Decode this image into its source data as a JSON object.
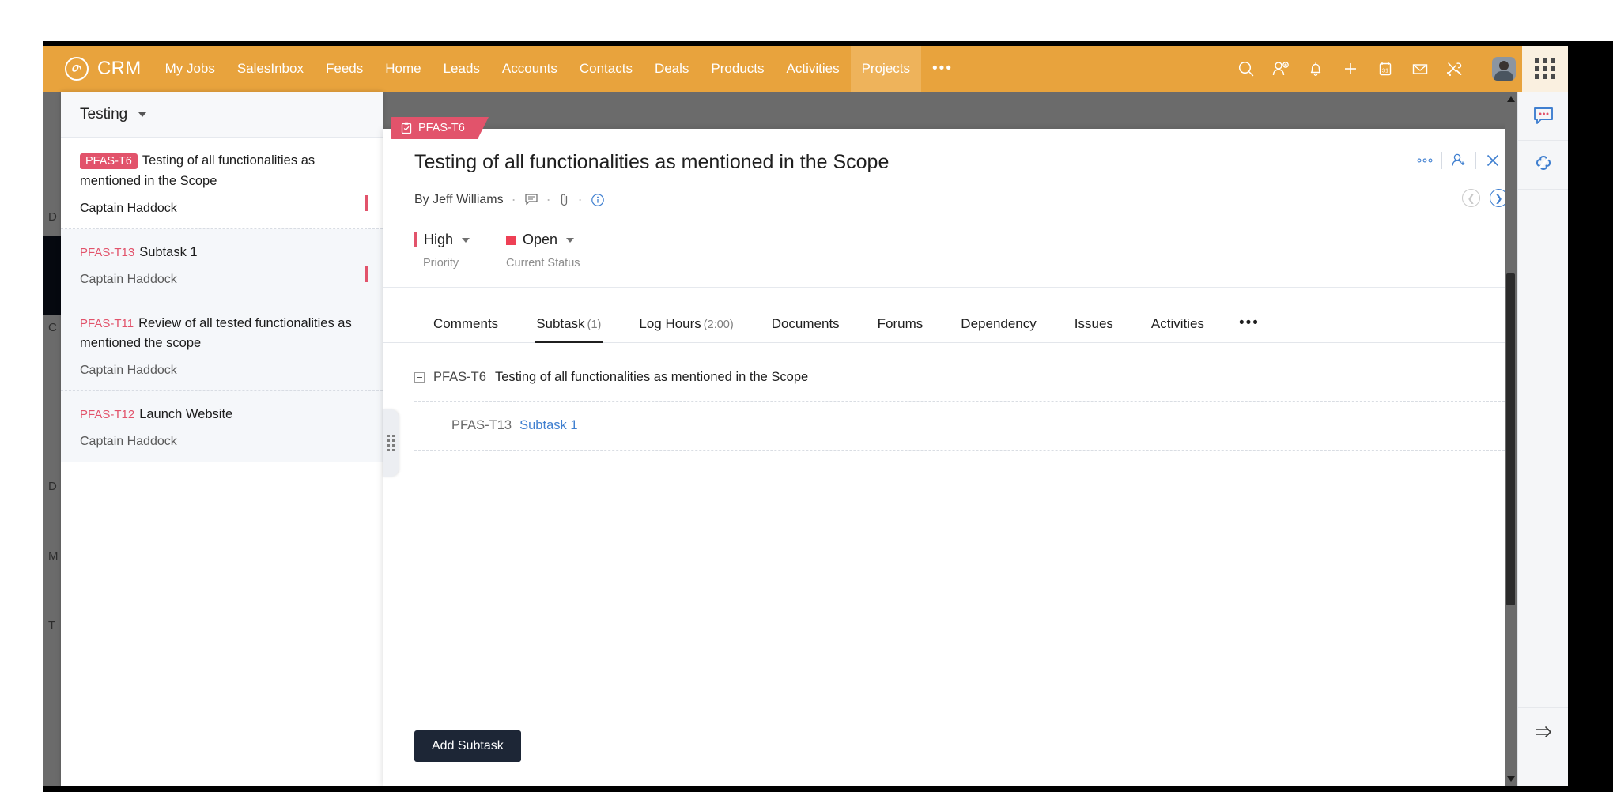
{
  "topnav": {
    "brand": "CRM",
    "brand_icon": "crm-logo-icon",
    "items": [
      {
        "label": "My Jobs",
        "active": false
      },
      {
        "label": "SalesInbox",
        "active": false
      },
      {
        "label": "Feeds",
        "active": false
      },
      {
        "label": "Home",
        "active": false
      },
      {
        "label": "Leads",
        "active": false
      },
      {
        "label": "Accounts",
        "active": false
      },
      {
        "label": "Contacts",
        "active": false
      },
      {
        "label": "Deals",
        "active": false
      },
      {
        "label": "Products",
        "active": false
      },
      {
        "label": "Activities",
        "active": false
      },
      {
        "label": "Projects",
        "active": true
      }
    ],
    "overflow_label": "•••",
    "icons": [
      "search-icon",
      "add-user-icon",
      "bell-icon",
      "plus-icon",
      "calendar-icon",
      "envelope-icon",
      "tools-icon"
    ],
    "calendar_day": "31",
    "accent_color": "#e8a33d",
    "active_tab_color": "#eeb35b"
  },
  "background_nav": {
    "labels": [
      "D",
      "C",
      "D",
      "M",
      "T"
    ]
  },
  "tasklist": {
    "title": "Testing",
    "dropdown_icon": "chevron-down-icon",
    "items": [
      {
        "key": "PFAS-T6",
        "name": "Testing of all functionalities as mentioned in the Scope",
        "owner": "Captain Haddock",
        "selected": true,
        "has_bar": true
      },
      {
        "key": "PFAS-T13",
        "name": "Subtask 1",
        "owner": "Captain Haddock",
        "selected": false,
        "has_bar": true
      },
      {
        "key": "PFAS-T11",
        "name": "Review of all tested functionalities as mentioned the scope",
        "owner": "Captain Haddock",
        "selected": false,
        "has_bar": false
      },
      {
        "key": "PFAS-T12",
        "name": "Launch Website",
        "owner": "Captain Haddock",
        "selected": false,
        "has_bar": false
      }
    ]
  },
  "detail": {
    "key_tag": "PFAS-T6",
    "key_tag_icon": "clipboard-check-icon",
    "title": "Testing of all functionalities as mentioned in the Scope",
    "byline": "By Jeff Williams",
    "byline_icons": [
      "comment-icon",
      "attachment-icon",
      "info-icon"
    ],
    "actions": [
      "more-options-icon",
      "add-user-icon",
      "close-icon"
    ],
    "nav_prev_icon": "chevron-left-icon",
    "nav_next_icon": "chevron-right-icon",
    "meta": {
      "priority_value": "High",
      "priority_label": "Priority",
      "priority_color": "#e2536b",
      "status_value": "Open",
      "status_label": "Current Status",
      "status_color": "#ee4055"
    },
    "tabs": [
      {
        "label": "Comments",
        "count": "",
        "active": false
      },
      {
        "label": "Subtask",
        "count": "(1)",
        "active": true
      },
      {
        "label": "Log Hours",
        "count": "(2:00)",
        "active": false
      },
      {
        "label": "Documents",
        "count": "",
        "active": false
      },
      {
        "label": "Forums",
        "count": "",
        "active": false
      },
      {
        "label": "Dependency",
        "count": "",
        "active": false
      },
      {
        "label": "Issues",
        "count": "",
        "active": false
      },
      {
        "label": "Activities",
        "count": "",
        "active": false
      }
    ],
    "tabs_overflow": "•••",
    "subtask": {
      "parent_key": "PFAS-T6",
      "parent_name": "Testing of all functionalities as mentioned in the Scope",
      "child_key": "PFAS-T13",
      "child_name": "Subtask 1",
      "child_link_color": "#3f7fd0"
    },
    "add_subtask_label": "Add Subtask",
    "add_subtask_color": "#1d2636"
  },
  "rail": {
    "icons": [
      "chat-bubble-icon",
      "extensions-icon"
    ],
    "bottom_icon": "collapse-arrow-icon"
  }
}
